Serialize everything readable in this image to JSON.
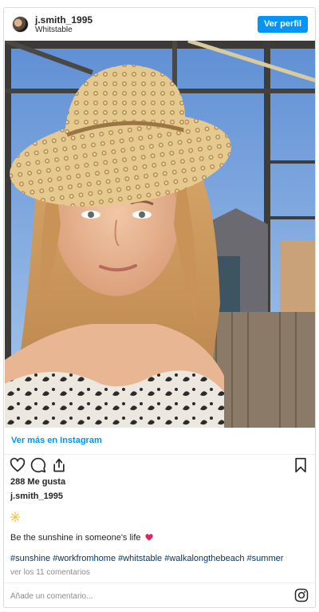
{
  "header": {
    "username": "j.smith_1995",
    "location": "Whitstable",
    "view_profile": "Ver perfil"
  },
  "post": {
    "see_more": "Ver más en Instagram",
    "likes": "288 Me gusta",
    "caption_username": "j.smith_1995",
    "caption_emoji": "sun-emoji",
    "caption_text": "Be the sunshine in someone's life",
    "caption_heart": "red-heart-emoji",
    "hashtags": "#sunshine #workfromhome #whitstable #walkalongthebeach #summer",
    "comments_link": "ver los 11 comentarios"
  },
  "comment_box": {
    "placeholder": "Añade un comentario..."
  },
  "icons": [
    "heart-icon",
    "comment-icon",
    "share-icon",
    "bookmark-icon",
    "instagram-icon"
  ],
  "colors": {
    "accent": "#0095f6",
    "hashtag": "#00376b",
    "muted": "#8e8e8e",
    "text": "#262626",
    "border": "#dbdbdb"
  }
}
